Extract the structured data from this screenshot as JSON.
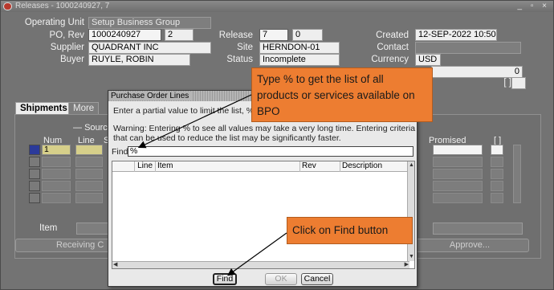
{
  "window": {
    "title": "Releases - 1000240927, 7",
    "controls": "_ ▫ ×"
  },
  "header": {
    "operating_unit_label": "Operating Unit",
    "operating_unit_value": "Setup Business Group",
    "po_rev_label": "PO, Rev",
    "po_value": "1000240927",
    "rev_value": "2",
    "release_label": "Release",
    "release_value": "7",
    "release_rev_value": "0",
    "created_label": "Created",
    "created_value": "12-SEP-2022 10:50",
    "supplier_label": "Supplier",
    "supplier_value": "QUADRANT INC",
    "site_label": "Site",
    "site_value": "HERNDON-01",
    "contact_label": "Contact",
    "contact_value": "",
    "buyer_label": "Buyer",
    "buyer_value": "RUYLE, ROBIN",
    "status_label": "Status",
    "status_value": "Incomplete",
    "currency_label": "Currency",
    "currency_value": "USD",
    "amount_value": "0",
    "bracket_label": "[ ]"
  },
  "tabs": [
    {
      "label": "Shipments",
      "active": true
    },
    {
      "label": "More",
      "active": false
    }
  ],
  "shipments": {
    "source_label": "Sourc",
    "col_num": "Num",
    "col_line": "Line",
    "col_s": "S",
    "col_promised": "Promised",
    "col_bracket": "[ ]",
    "first_num": "1",
    "item_label": "Item"
  },
  "buttons": {
    "receiving": "Receiving C",
    "approve": "Approve..."
  },
  "dialog": {
    "title": "Purchase Order Lines",
    "instruction": "Enter a partial value to limit the list, %",
    "warning_line1": "Warning: Entering % to see all values may take a very long time. Entering criteria",
    "warning_line2": "that can be used to reduce the list may be significantly faster.",
    "find_label": "Find",
    "find_value": "%",
    "columns": [
      "Line",
      "Item",
      "Rev",
      "Description"
    ],
    "btn_find": "Find",
    "btn_ok": "OK",
    "btn_cancel": "Cancel"
  },
  "callouts": {
    "type_percent": "Type % to get the list of all products or services available on BPO",
    "click_find": "Click on Find button"
  },
  "colors": {
    "callout": "#ed7d31",
    "current_record": "#2b3a9a",
    "required_field": "#d6cf8a"
  }
}
